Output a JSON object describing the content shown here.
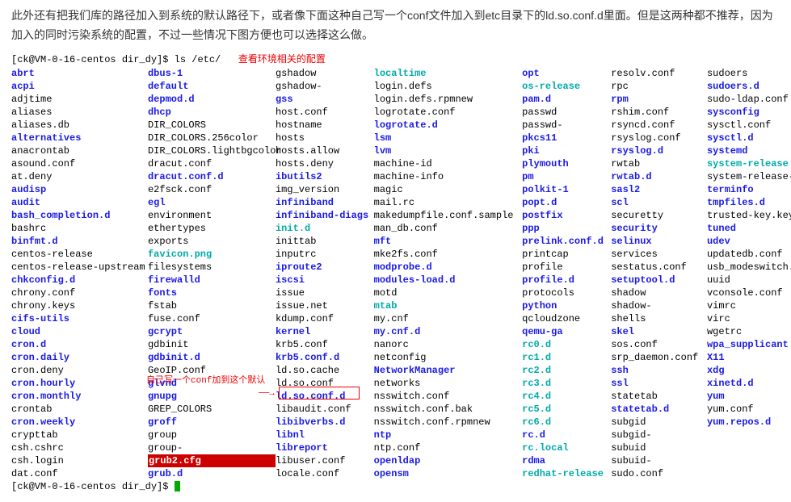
{
  "intro": "此外还有把我们库的路径加入到系统的默认路径下，或者像下面这种自己写一个conf文件加入到etc目录下的ld.so.conf.d里面。但是这两种都不推荐，因为加入的同时污染系统的配置，不过一些情况下图方便也可以选择这么做。",
  "prompt1": "[ck@VM-0-16-centos dir_dy]$ ls /etc/",
  "anno1": "查看环境相关的配置",
  "anno2": "自己写一个conf加到这个默认",
  "arrow": "──→",
  "prompt2": "[ck@VM-0-16-centos dir_dy]$ ",
  "box_target": "ld.so.conf.d",
  "cols": [
    [
      {
        "t": "abrt",
        "c": "blue"
      },
      {
        "t": "acpi",
        "c": "blue"
      },
      {
        "t": "adjtime",
        "c": "black"
      },
      {
        "t": "aliases",
        "c": "black"
      },
      {
        "t": "aliases.db",
        "c": "black"
      },
      {
        "t": "alternatives",
        "c": "blue"
      },
      {
        "t": "anacrontab",
        "c": "black"
      },
      {
        "t": "asound.conf",
        "c": "black"
      },
      {
        "t": "at.deny",
        "c": "black"
      },
      {
        "t": "audisp",
        "c": "blue"
      },
      {
        "t": "audit",
        "c": "blue"
      },
      {
        "t": "bash_completion.d",
        "c": "blue"
      },
      {
        "t": "bashrc",
        "c": "black"
      },
      {
        "t": "binfmt.d",
        "c": "blue"
      },
      {
        "t": "centos-release",
        "c": "black"
      },
      {
        "t": "centos-release-upstream",
        "c": "black"
      },
      {
        "t": "chkconfig.d",
        "c": "blue"
      },
      {
        "t": "chrony.conf",
        "c": "black"
      },
      {
        "t": "chrony.keys",
        "c": "black"
      },
      {
        "t": "cifs-utils",
        "c": "blue"
      },
      {
        "t": "cloud",
        "c": "blue"
      },
      {
        "t": "cron.d",
        "c": "blue"
      },
      {
        "t": "cron.daily",
        "c": "blue"
      },
      {
        "t": "cron.deny",
        "c": "black"
      },
      {
        "t": "cron.hourly",
        "c": "blue"
      },
      {
        "t": "cron.monthly",
        "c": "blue"
      },
      {
        "t": "crontab",
        "c": "black"
      },
      {
        "t": "cron.weekly",
        "c": "blue"
      },
      {
        "t": "crypttab",
        "c": "black"
      },
      {
        "t": "csh.cshrc",
        "c": "black"
      },
      {
        "t": "csh.login",
        "c": "black"
      },
      {
        "t": "dat.conf",
        "c": "black"
      }
    ],
    [
      {
        "t": "dbus-1",
        "c": "blue"
      },
      {
        "t": "default",
        "c": "blue"
      },
      {
        "t": "depmod.d",
        "c": "blue"
      },
      {
        "t": "dhcp",
        "c": "blue"
      },
      {
        "t": "DIR_COLORS",
        "c": "black"
      },
      {
        "t": "DIR_COLORS.256color",
        "c": "black"
      },
      {
        "t": "DIR_COLORS.lightbgcolor",
        "c": "black"
      },
      {
        "t": "dracut.conf",
        "c": "black"
      },
      {
        "t": "dracut.conf.d",
        "c": "blue"
      },
      {
        "t": "e2fsck.conf",
        "c": "black"
      },
      {
        "t": "egl",
        "c": "blue"
      },
      {
        "t": "environment",
        "c": "black"
      },
      {
        "t": "ethertypes",
        "c": "black"
      },
      {
        "t": "exports",
        "c": "black"
      },
      {
        "t": "favicon.png",
        "c": "cyan"
      },
      {
        "t": "filesystems",
        "c": "black"
      },
      {
        "t": "firewalld",
        "c": "blue"
      },
      {
        "t": "fonts",
        "c": "blue"
      },
      {
        "t": "fstab",
        "c": "black"
      },
      {
        "t": "fuse.conf",
        "c": "black"
      },
      {
        "t": "gcrypt",
        "c": "blue"
      },
      {
        "t": "gdbinit",
        "c": "black"
      },
      {
        "t": "gdbinit.d",
        "c": "blue"
      },
      {
        "t": "GeoIP.conf",
        "c": "black"
      },
      {
        "t": "glvnd",
        "c": "blue"
      },
      {
        "t": "gnupg",
        "c": "blue"
      },
      {
        "t": "GREP_COLORS",
        "c": "black"
      },
      {
        "t": "groff",
        "c": "blue"
      },
      {
        "t": "group",
        "c": "black"
      },
      {
        "t": "group-",
        "c": "black"
      },
      {
        "t": "grub2.cfg",
        "c": "redhl"
      },
      {
        "t": "grub.d",
        "c": "blue"
      }
    ],
    [
      {
        "t": "gshadow",
        "c": "black"
      },
      {
        "t": "gshadow-",
        "c": "black"
      },
      {
        "t": "gss",
        "c": "blue"
      },
      {
        "t": "host.conf",
        "c": "black"
      },
      {
        "t": "hostname",
        "c": "black"
      },
      {
        "t": "hosts",
        "c": "black"
      },
      {
        "t": "hosts.allow",
        "c": "black"
      },
      {
        "t": "hosts.deny",
        "c": "black"
      },
      {
        "t": "ibutils2",
        "c": "blue"
      },
      {
        "t": "img_version",
        "c": "black"
      },
      {
        "t": "infiniband",
        "c": "blue"
      },
      {
        "t": "infiniband-diags",
        "c": "blue"
      },
      {
        "t": "init.d",
        "c": "cyan"
      },
      {
        "t": "inittab",
        "c": "black"
      },
      {
        "t": "inputrc",
        "c": "black"
      },
      {
        "t": "iproute2",
        "c": "blue"
      },
      {
        "t": "iscsi",
        "c": "blue"
      },
      {
        "t": "issue",
        "c": "black"
      },
      {
        "t": "issue.net",
        "c": "black"
      },
      {
        "t": "kdump.conf",
        "c": "black"
      },
      {
        "t": "kernel",
        "c": "blue"
      },
      {
        "t": "krb5.conf",
        "c": "black"
      },
      {
        "t": "krb5.conf.d",
        "c": "blue"
      },
      {
        "t": "ld.so.cache",
        "c": "black"
      },
      {
        "t": "ld.so.conf",
        "c": "black"
      },
      {
        "t": "ld.so.conf.d",
        "c": "blue"
      },
      {
        "t": "libaudit.conf",
        "c": "black"
      },
      {
        "t": "libibverbs.d",
        "c": "blue"
      },
      {
        "t": "libnl",
        "c": "blue"
      },
      {
        "t": "libreport",
        "c": "blue"
      },
      {
        "t": "libuser.conf",
        "c": "black"
      },
      {
        "t": "locale.conf",
        "c": "black"
      }
    ],
    [
      {
        "t": "localtime",
        "c": "cyan"
      },
      {
        "t": "login.defs",
        "c": "black"
      },
      {
        "t": "login.defs.rpmnew",
        "c": "black"
      },
      {
        "t": "logrotate.conf",
        "c": "black"
      },
      {
        "t": "logrotate.d",
        "c": "blue"
      },
      {
        "t": "lsm",
        "c": "blue"
      },
      {
        "t": "lvm",
        "c": "blue"
      },
      {
        "t": "machine-id",
        "c": "black"
      },
      {
        "t": "machine-info",
        "c": "black"
      },
      {
        "t": "magic",
        "c": "black"
      },
      {
        "t": "mail.rc",
        "c": "black"
      },
      {
        "t": "makedumpfile.conf.sample",
        "c": "black"
      },
      {
        "t": "man_db.conf",
        "c": "black"
      },
      {
        "t": "mft",
        "c": "blue"
      },
      {
        "t": "mke2fs.conf",
        "c": "black"
      },
      {
        "t": "modprobe.d",
        "c": "blue"
      },
      {
        "t": "modules-load.d",
        "c": "blue"
      },
      {
        "t": "motd",
        "c": "black"
      },
      {
        "t": "mtab",
        "c": "cyan"
      },
      {
        "t": "my.cnf",
        "c": "black"
      },
      {
        "t": "my.cnf.d",
        "c": "blue"
      },
      {
        "t": "nanorc",
        "c": "black"
      },
      {
        "t": "netconfig",
        "c": "black"
      },
      {
        "t": "NetworkManager",
        "c": "blue"
      },
      {
        "t": "networks",
        "c": "black"
      },
      {
        "t": "nsswitch.conf",
        "c": "black"
      },
      {
        "t": "nsswitch.conf.bak",
        "c": "black"
      },
      {
        "t": "nsswitch.conf.rpmnew",
        "c": "black"
      },
      {
        "t": "ntp",
        "c": "blue"
      },
      {
        "t": "ntp.conf",
        "c": "black"
      },
      {
        "t": "openldap",
        "c": "blue"
      },
      {
        "t": "opensm",
        "c": "blue"
      }
    ],
    [
      {
        "t": "opt",
        "c": "blue"
      },
      {
        "t": "os-release",
        "c": "cyan"
      },
      {
        "t": "pam.d",
        "c": "blue"
      },
      {
        "t": "passwd",
        "c": "black"
      },
      {
        "t": "passwd-",
        "c": "black"
      },
      {
        "t": "pkcs11",
        "c": "blue"
      },
      {
        "t": "pki",
        "c": "blue"
      },
      {
        "t": "plymouth",
        "c": "blue"
      },
      {
        "t": "pm",
        "c": "blue"
      },
      {
        "t": "polkit-1",
        "c": "blue"
      },
      {
        "t": "popt.d",
        "c": "blue"
      },
      {
        "t": "postfix",
        "c": "blue"
      },
      {
        "t": "ppp",
        "c": "blue"
      },
      {
        "t": "prelink.conf.d",
        "c": "blue"
      },
      {
        "t": "printcap",
        "c": "black"
      },
      {
        "t": "profile",
        "c": "black"
      },
      {
        "t": "profile.d",
        "c": "blue"
      },
      {
        "t": "protocols",
        "c": "black"
      },
      {
        "t": "python",
        "c": "blue"
      },
      {
        "t": "qcloudzone",
        "c": "black"
      },
      {
        "t": "qemu-ga",
        "c": "blue"
      },
      {
        "t": "rc0.d",
        "c": "cyan"
      },
      {
        "t": "rc1.d",
        "c": "cyan"
      },
      {
        "t": "rc2.d",
        "c": "cyan"
      },
      {
        "t": "rc3.d",
        "c": "cyan"
      },
      {
        "t": "rc4.d",
        "c": "cyan"
      },
      {
        "t": "rc5.d",
        "c": "cyan"
      },
      {
        "t": "rc6.d",
        "c": "cyan"
      },
      {
        "t": "rc.d",
        "c": "blue"
      },
      {
        "t": "rc.local",
        "c": "cyan"
      },
      {
        "t": "rdma",
        "c": "blue"
      },
      {
        "t": "redhat-release",
        "c": "cyan"
      }
    ],
    [
      {
        "t": "resolv.conf",
        "c": "black"
      },
      {
        "t": "rpc",
        "c": "black"
      },
      {
        "t": "rpm",
        "c": "blue"
      },
      {
        "t": "rshim.conf",
        "c": "black"
      },
      {
        "t": "rsyncd.conf",
        "c": "black"
      },
      {
        "t": "rsyslog.conf",
        "c": "black"
      },
      {
        "t": "rsyslog.d",
        "c": "blue"
      },
      {
        "t": "rwtab",
        "c": "black"
      },
      {
        "t": "rwtab.d",
        "c": "blue"
      },
      {
        "t": "sasl2",
        "c": "blue"
      },
      {
        "t": "scl",
        "c": "blue"
      },
      {
        "t": "securetty",
        "c": "black"
      },
      {
        "t": "security",
        "c": "blue"
      },
      {
        "t": "selinux",
        "c": "blue"
      },
      {
        "t": "services",
        "c": "black"
      },
      {
        "t": "sestatus.conf",
        "c": "black"
      },
      {
        "t": "setuptool.d",
        "c": "blue"
      },
      {
        "t": "shadow",
        "c": "black"
      },
      {
        "t": "shadow-",
        "c": "black"
      },
      {
        "t": "shells",
        "c": "black"
      },
      {
        "t": "skel",
        "c": "blue"
      },
      {
        "t": "sos.conf",
        "c": "black"
      },
      {
        "t": "srp_daemon.conf",
        "c": "black"
      },
      {
        "t": "ssh",
        "c": "blue"
      },
      {
        "t": "ssl",
        "c": "blue"
      },
      {
        "t": "statetab",
        "c": "black"
      },
      {
        "t": "statetab.d",
        "c": "blue"
      },
      {
        "t": "subgid",
        "c": "black"
      },
      {
        "t": "subgid-",
        "c": "black"
      },
      {
        "t": "subuid",
        "c": "black"
      },
      {
        "t": "subuid-",
        "c": "black"
      },
      {
        "t": "sudo.conf",
        "c": "black"
      }
    ],
    [
      {
        "t": "sudoers",
        "c": "black"
      },
      {
        "t": "sudoers.d",
        "c": "blue"
      },
      {
        "t": "sudo-ldap.conf",
        "c": "black"
      },
      {
        "t": "sysconfig",
        "c": "blue"
      },
      {
        "t": "sysctl.conf",
        "c": "black"
      },
      {
        "t": "sysctl.d",
        "c": "blue"
      },
      {
        "t": "systemd",
        "c": "blue"
      },
      {
        "t": "system-release",
        "c": "cyan"
      },
      {
        "t": "system-release-cpe",
        "c": "black"
      },
      {
        "t": "terminfo",
        "c": "blue"
      },
      {
        "t": "tmpfiles.d",
        "c": "blue"
      },
      {
        "t": "trusted-key.key",
        "c": "black"
      },
      {
        "t": "tuned",
        "c": "blue"
      },
      {
        "t": "udev",
        "c": "blue"
      },
      {
        "t": "updatedb.conf",
        "c": "black"
      },
      {
        "t": "usb_modeswitch.conf",
        "c": "black"
      },
      {
        "t": "uuid",
        "c": "black"
      },
      {
        "t": "vconsole.conf",
        "c": "black"
      },
      {
        "t": "vimrc",
        "c": "black"
      },
      {
        "t": "virc",
        "c": "black"
      },
      {
        "t": "wgetrc",
        "c": "black"
      },
      {
        "t": "wpa_supplicant",
        "c": "blue"
      },
      {
        "t": "X11",
        "c": "blue"
      },
      {
        "t": "xdg",
        "c": "blue"
      },
      {
        "t": "xinetd.d",
        "c": "blue"
      },
      {
        "t": "yum",
        "c": "blue"
      },
      {
        "t": "yum.conf",
        "c": "black"
      },
      {
        "t": "yum.repos.d",
        "c": "blue"
      }
    ]
  ]
}
